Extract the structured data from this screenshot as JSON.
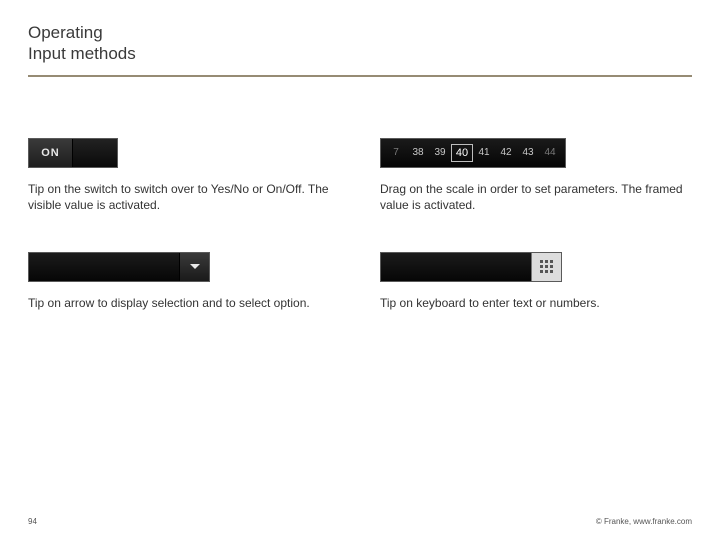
{
  "title": {
    "line1": "Operating",
    "line2": "Input methods"
  },
  "cells": {
    "toggle": {
      "on_label": "ON",
      "caption": "Tip on the switch to switch over to Yes/No or On/Off. The visible value is activated."
    },
    "scale": {
      "ticks": [
        "7",
        "38",
        "39",
        "40",
        "41",
        "42",
        "43",
        "44"
      ],
      "selected": "40",
      "caption": "Drag on the scale in order to set parameters. The framed value is activated."
    },
    "dropdown": {
      "caption": "Tip on arrow to display selection and to select option."
    },
    "keyboard": {
      "caption": "Tip on keyboard to enter text or numbers."
    }
  },
  "footer": {
    "page": "94",
    "copyright": "© Franke, www.franke.com"
  }
}
